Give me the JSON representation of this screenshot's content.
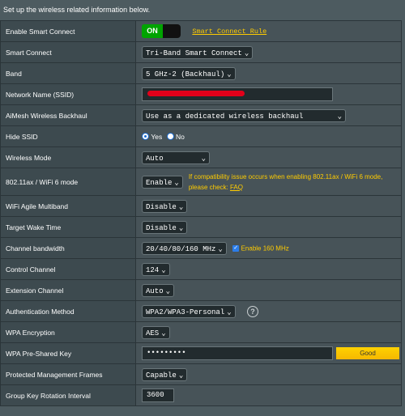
{
  "intro": "Set up the wireless related information below.",
  "rows": {
    "smart_connect_enable": {
      "label": "Enable Smart Connect",
      "toggle_on": "ON",
      "rule_link": "Smart Connect Rule"
    },
    "smart_connect": {
      "label": "Smart Connect",
      "value": "Tri-Band Smart Connect"
    },
    "band": {
      "label": "Band",
      "value": "5 GHz-2 (Backhaul)"
    },
    "ssid": {
      "label": "Network Name (SSID)",
      "value": ""
    },
    "aimesh": {
      "label": "AiMesh Wireless Backhaul",
      "value": "Use as a dedicated wireless backhaul"
    },
    "hide_ssid": {
      "label": "Hide SSID",
      "yes": "Yes",
      "no": "No",
      "selected": "Yes"
    },
    "wireless_mode": {
      "label": "Wireless Mode",
      "value": "Auto"
    },
    "wifi6": {
      "label": "802.11ax / WiFi 6 mode",
      "value": "Enable",
      "note": "If compatibility issue occurs when enabling 802.11ax / WiFi 6 mode,",
      "note2": "please check:",
      "faq": "FAQ"
    },
    "agile_multiband": {
      "label": "WiFi Agile Multiband",
      "value": "Disable"
    },
    "target_wake": {
      "label": "Target Wake Time",
      "value": "Disable"
    },
    "bandwidth": {
      "label": "Channel bandwidth",
      "value": "20/40/80/160 MHz",
      "checkbox_label": "Enable 160 MHz",
      "checked": true
    },
    "control_channel": {
      "label": "Control Channel",
      "value": "124"
    },
    "extension_channel": {
      "label": "Extension Channel",
      "value": "Auto"
    },
    "auth": {
      "label": "Authentication Method",
      "value": "WPA2/WPA3-Personal"
    },
    "encryption": {
      "label": "WPA Encryption",
      "value": "AES"
    },
    "psk": {
      "label": "WPA Pre-Shared Key",
      "value": "•••••••••",
      "strength": "Good"
    },
    "pmf": {
      "label": "Protected Management Frames",
      "value": "Capable"
    },
    "gkri": {
      "label": "Group Key Rotation Interval",
      "value": "3600"
    }
  },
  "colors": {
    "accent": "#ffcc00",
    "toggle_on": "#00a400",
    "strength": "#ffd200"
  }
}
